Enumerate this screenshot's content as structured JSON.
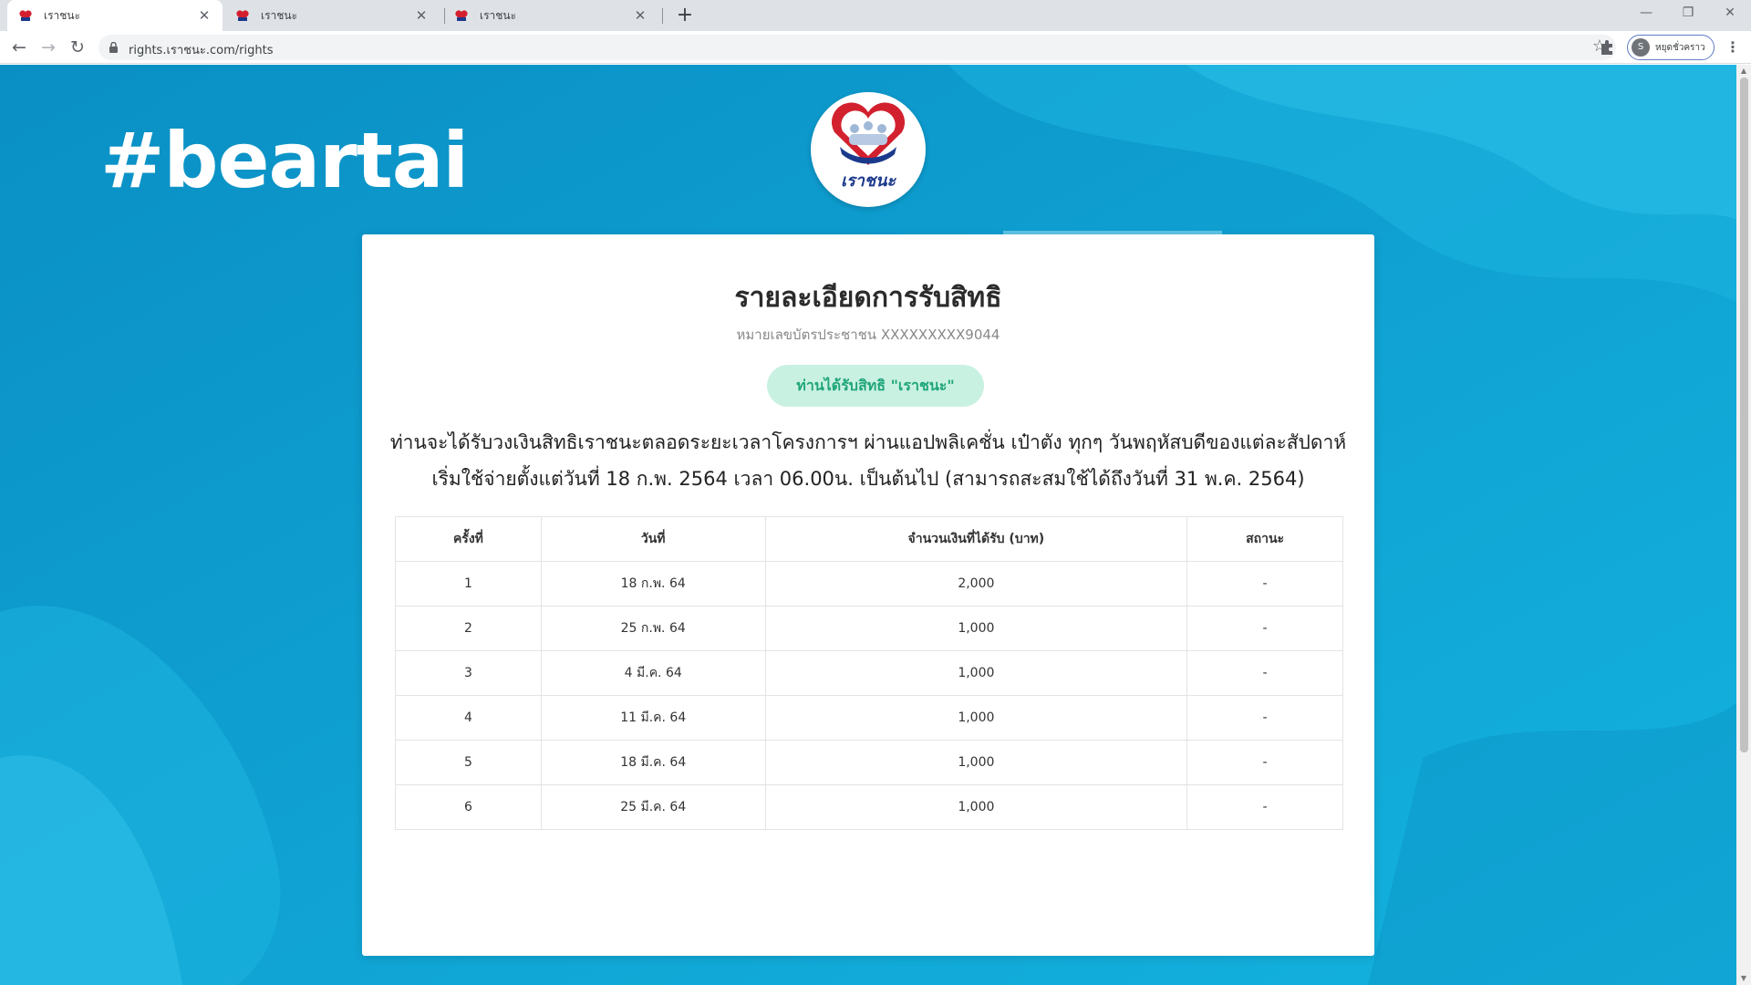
{
  "browser": {
    "tabs": [
      {
        "title": "เราชนะ",
        "active": true
      },
      {
        "title": "เราชนะ",
        "active": false
      },
      {
        "title": "เราชนะ",
        "active": false
      }
    ],
    "new_tab": "+",
    "url": "rights.เราชนะ.com/rights",
    "profile": {
      "initial": "S",
      "label": "หยุดชั่วคราว"
    }
  },
  "page": {
    "watermark": "#beartai",
    "logo_text": "เราชนะ",
    "title": "รายละเอียดการรับสิทธิ",
    "id_label": "หมายเลขบัตรประชาชน XXXXXXXXX9044",
    "status_badge": "ท่านได้รับสิทธิ \"เราชนะ\"",
    "description_line1": "ท่านจะได้รับวงเงินสิทธิเราชนะตลอดระยะเวลาโครงการฯ ผ่านแอปพลิเคชั่น เป๋าตัง ทุกๆ วันพฤหัสบดีของแต่ละสัปดาห์",
    "description_line2": "เริ่มใช้จ่ายตั้งแต่วันที่ 18 ก.พ. 2564 เวลา 06.00น. เป็นต้นไป (สามารถสะสมใช้ได้ถึงวันที่ 31 พ.ค. 2564)",
    "table": {
      "headers": [
        "ครั้งที่",
        "วันที่",
        "จำนวนเงินที่ได้รับ (บาท)",
        "สถานะ"
      ],
      "rows": [
        [
          "1",
          "18 ก.พ. 64",
          "2,000",
          "-"
        ],
        [
          "2",
          "25 ก.พ. 64",
          "1,000",
          "-"
        ],
        [
          "3",
          "4 มี.ค. 64",
          "1,000",
          "-"
        ],
        [
          "4",
          "11 มี.ค. 64",
          "1,000",
          "-"
        ],
        [
          "5",
          "18 มี.ค. 64",
          "1,000",
          "-"
        ],
        [
          "6",
          "25 มี.ค. 64",
          "1,000",
          "-"
        ]
      ]
    }
  },
  "colors": {
    "background": "#0fa0d2",
    "badge_bg": "#c9f1e2",
    "badge_text": "#1fa57a",
    "logo_heart": "#d3202e",
    "logo_blue": "#1c3a8c"
  }
}
